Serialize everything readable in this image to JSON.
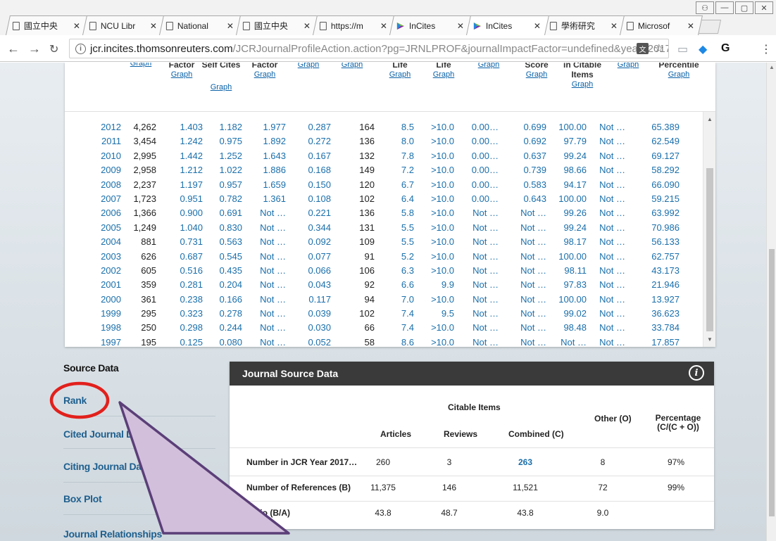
{
  "browser": {
    "tabs": [
      {
        "title": "國立中央",
        "icon": "doc"
      },
      {
        "title": "NCU Libr",
        "icon": "doc"
      },
      {
        "title": "National",
        "icon": "doc"
      },
      {
        "title": "國立中央",
        "icon": "doc"
      },
      {
        "title": "https://m",
        "icon": "doc"
      },
      {
        "title": "InCites",
        "icon": "prism"
      },
      {
        "title": "InCites",
        "icon": "prism",
        "active": true
      },
      {
        "title": "學術研究",
        "icon": "doc"
      },
      {
        "title": "Microsof",
        "icon": "doc"
      }
    ],
    "tab_close": "✕",
    "url_host": "jcr.incites.thomsonreuters.com",
    "url_path": "/JCRJournalProfileAction.action?pg=JRNLPROF&journalImpactFactor=undefined&year=2017...",
    "window_controls": [
      "⚇",
      "—",
      "▢",
      "✕"
    ]
  },
  "table": {
    "headers": [
      {
        "title": "",
        "link": "Graph"
      },
      {
        "title": "Factor",
        "link": "Graph"
      },
      {
        "title": "Self Cites",
        "link": "Graph"
      },
      {
        "title": "Factor",
        "link": "Graph"
      },
      {
        "title": "",
        "link": "Graph"
      },
      {
        "title": "",
        "link": "Graph"
      },
      {
        "title": "Life",
        "link": "Graph"
      },
      {
        "title": "Life",
        "link": "Graph"
      },
      {
        "title": "",
        "link": "Graph"
      },
      {
        "title": "Score",
        "link": "Graph"
      },
      {
        "title": "in Citable Items",
        "link": "Graph"
      },
      {
        "title": "",
        "link": "Graph"
      },
      {
        "title": "Percentile",
        "link": "Graph"
      }
    ],
    "rows": [
      [
        "2012",
        "4,262",
        "1.403",
        "1.182",
        "1.977",
        "0.287",
        "164",
        "8.5",
        ">10.0",
        "0.00…",
        "0.699",
        "100.00",
        "Not …",
        "65.389"
      ],
      [
        "2011",
        "3,454",
        "1.242",
        "0.975",
        "1.892",
        "0.272",
        "136",
        "8.0",
        ">10.0",
        "0.00…",
        "0.692",
        "97.79",
        "Not …",
        "62.549"
      ],
      [
        "2010",
        "2,995",
        "1.442",
        "1.252",
        "1.643",
        "0.167",
        "132",
        "7.8",
        ">10.0",
        "0.00…",
        "0.637",
        "99.24",
        "Not …",
        "69.127"
      ],
      [
        "2009",
        "2,958",
        "1.212",
        "1.022",
        "1.886",
        "0.168",
        "149",
        "7.2",
        ">10.0",
        "0.00…",
        "0.739",
        "98.66",
        "Not …",
        "58.292"
      ],
      [
        "2008",
        "2,237",
        "1.197",
        "0.957",
        "1.659",
        "0.150",
        "120",
        "6.7",
        ">10.0",
        "0.00…",
        "0.583",
        "94.17",
        "Not …",
        "66.090"
      ],
      [
        "2007",
        "1,723",
        "0.951",
        "0.782",
        "1.361",
        "0.108",
        "102",
        "6.4",
        ">10.0",
        "0.00…",
        "0.643",
        "100.00",
        "Not …",
        "59.215"
      ],
      [
        "2006",
        "1,366",
        "0.900",
        "0.691",
        "Not …",
        "0.221",
        "136",
        "5.8",
        ">10.0",
        "Not …",
        "Not …",
        "99.26",
        "Not …",
        "63.992"
      ],
      [
        "2005",
        "1,249",
        "1.040",
        "0.830",
        "Not …",
        "0.344",
        "131",
        "5.5",
        ">10.0",
        "Not …",
        "Not …",
        "99.24",
        "Not …",
        "70.986"
      ],
      [
        "2004",
        "881",
        "0.731",
        "0.563",
        "Not …",
        "0.092",
        "109",
        "5.5",
        ">10.0",
        "Not …",
        "Not …",
        "98.17",
        "Not …",
        "56.133"
      ],
      [
        "2003",
        "626",
        "0.687",
        "0.545",
        "Not …",
        "0.077",
        "91",
        "5.2",
        ">10.0",
        "Not …",
        "Not …",
        "100.00",
        "Not …",
        "62.757"
      ],
      [
        "2002",
        "605",
        "0.516",
        "0.435",
        "Not …",
        "0.066",
        "106",
        "6.3",
        ">10.0",
        "Not …",
        "Not …",
        "98.11",
        "Not …",
        "43.173"
      ],
      [
        "2001",
        "359",
        "0.281",
        "0.204",
        "Not …",
        "0.043",
        "92",
        "6.6",
        "9.9",
        "Not …",
        "Not …",
        "97.83",
        "Not …",
        "21.946"
      ],
      [
        "2000",
        "361",
        "0.238",
        "0.166",
        "Not …",
        "0.117",
        "94",
        "7.0",
        ">10.0",
        "Not …",
        "Not …",
        "100.00",
        "Not …",
        "13.927"
      ],
      [
        "1999",
        "295",
        "0.323",
        "0.278",
        "Not …",
        "0.039",
        "102",
        "7.4",
        "9.5",
        "Not …",
        "Not …",
        "99.02",
        "Not …",
        "36.623"
      ],
      [
        "1998",
        "250",
        "0.298",
        "0.244",
        "Not …",
        "0.030",
        "66",
        "7.4",
        ">10.0",
        "Not …",
        "Not …",
        "98.48",
        "Not …",
        "33.784"
      ],
      [
        "1997",
        "195",
        "0.125",
        "0.080",
        "Not …",
        "0.052",
        "58",
        "8.6",
        ">10.0",
        "Not …",
        "Not …",
        "Not …",
        "Not …",
        "17.857"
      ]
    ]
  },
  "sidenav": {
    "title": "Source Data",
    "items": [
      "Rank",
      "Cited Journal Data",
      "Citing Journal Data",
      "Box Plot",
      "Journal Relationships"
    ]
  },
  "source_data": {
    "title": "Journal Source Data",
    "info": "i",
    "group_header": "Citable Items",
    "columns": [
      "Articles",
      "Reviews",
      "Combined  (C)",
      "Other (O)",
      "Percentage (C/(C + O))"
    ],
    "rows": [
      {
        "label": "Number in JCR Year 2017…",
        "values": [
          "260",
          "3",
          "263",
          "8",
          "97%"
        ]
      },
      {
        "label": "Number of References (B)",
        "values": [
          "11,375",
          "146",
          "11,521",
          "72",
          "99%"
        ]
      },
      {
        "label": "Ratio (B/A)",
        "values": [
          "43.8",
          "48.7",
          "43.8",
          "9.0",
          ""
        ]
      }
    ]
  },
  "colors": {
    "link_blue": "#1a6fab",
    "annotation_red": "#e2201c",
    "callout_fill": "#d2bfdc",
    "callout_stroke": "#5b3f78"
  }
}
